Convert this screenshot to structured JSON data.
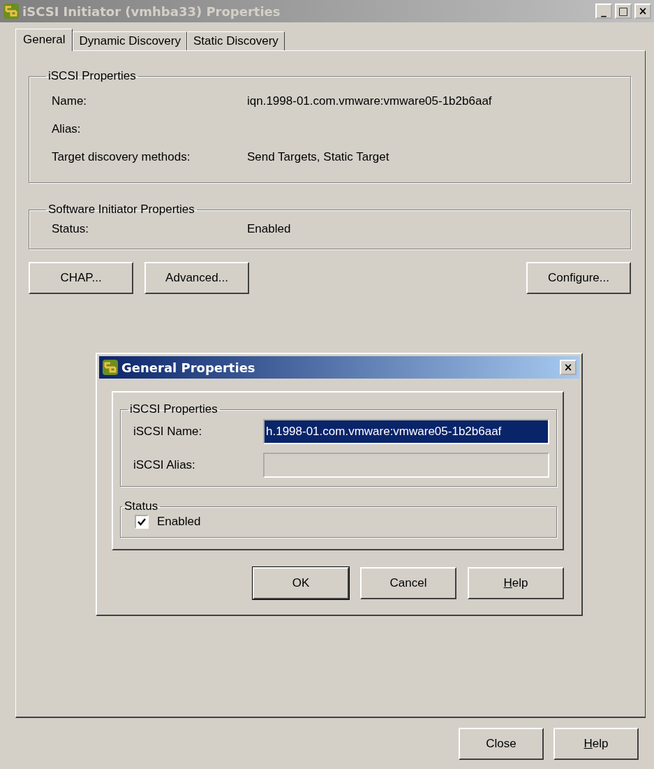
{
  "window": {
    "title": "iSCSI Initiator (vmhba33) Properties",
    "controls": [
      "_",
      "□",
      "×"
    ]
  },
  "tabs": [
    {
      "label": "General",
      "selected": true
    },
    {
      "label": "Dynamic Discovery",
      "selected": false
    },
    {
      "label": "Static Discovery",
      "selected": false
    }
  ],
  "iscsi_properties": {
    "title": "iSCSI Properties",
    "rows": [
      {
        "label": "Name:",
        "value": "iqn.1998-01.com.vmware:vmware05-1b2b6aaf"
      },
      {
        "label": "Alias:"
      },
      {
        "label": "Target discovery methods:",
        "value": "Send Targets, Static Target"
      }
    ]
  },
  "software_initiator": {
    "title": "Software Initiator Properties",
    "rows": [
      {
        "label": "Status:",
        "value": "Enabled"
      }
    ]
  },
  "left_actions": [
    {
      "label": "CHAP..."
    },
    {
      "label": "Advanced..."
    }
  ],
  "right_actions": [
    {
      "label": "Configure..."
    }
  ],
  "dialog": {
    "title": "General Properties",
    "close": "×",
    "iscsi_properties": {
      "title": "iSCSI Properties",
      "fields": [
        {
          "label": "iSCSI Name:",
          "value": "h.1998-01.com.vmware:vmware05-1b2b6aaf",
          "selected": true,
          "disabled": false
        },
        {
          "label": "iSCSI Alias:",
          "disabled": true
        }
      ]
    },
    "status": {
      "title": "Status",
      "checkbox": {
        "label": "Enabled",
        "checked": true
      }
    },
    "buttons": [
      {
        "label": "OK",
        "default": true,
        "underline_first": false
      },
      {
        "label": "Cancel",
        "default": false,
        "underline_first": false
      },
      {
        "label": "Help",
        "default": false,
        "underline_first": true
      }
    ]
  },
  "footer_buttons": [
    {
      "label": "Close",
      "underline_first": false
    },
    {
      "label": "Help",
      "underline_first": true
    }
  ]
}
